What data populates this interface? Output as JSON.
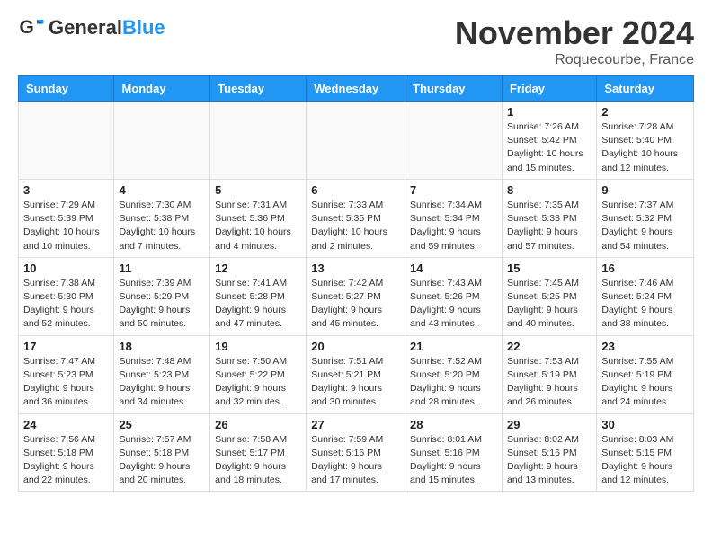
{
  "header": {
    "logo_line1": "General",
    "logo_line2": "Blue",
    "month": "November 2024",
    "location": "Roquecourbe, France"
  },
  "days_of_week": [
    "Sunday",
    "Monday",
    "Tuesday",
    "Wednesday",
    "Thursday",
    "Friday",
    "Saturday"
  ],
  "weeks": [
    [
      {
        "day": "",
        "info": ""
      },
      {
        "day": "",
        "info": ""
      },
      {
        "day": "",
        "info": ""
      },
      {
        "day": "",
        "info": ""
      },
      {
        "day": "",
        "info": ""
      },
      {
        "day": "1",
        "info": "Sunrise: 7:26 AM\nSunset: 5:42 PM\nDaylight: 10 hours and 15 minutes."
      },
      {
        "day": "2",
        "info": "Sunrise: 7:28 AM\nSunset: 5:40 PM\nDaylight: 10 hours and 12 minutes."
      }
    ],
    [
      {
        "day": "3",
        "info": "Sunrise: 7:29 AM\nSunset: 5:39 PM\nDaylight: 10 hours and 10 minutes."
      },
      {
        "day": "4",
        "info": "Sunrise: 7:30 AM\nSunset: 5:38 PM\nDaylight: 10 hours and 7 minutes."
      },
      {
        "day": "5",
        "info": "Sunrise: 7:31 AM\nSunset: 5:36 PM\nDaylight: 10 hours and 4 minutes."
      },
      {
        "day": "6",
        "info": "Sunrise: 7:33 AM\nSunset: 5:35 PM\nDaylight: 10 hours and 2 minutes."
      },
      {
        "day": "7",
        "info": "Sunrise: 7:34 AM\nSunset: 5:34 PM\nDaylight: 9 hours and 59 minutes."
      },
      {
        "day": "8",
        "info": "Sunrise: 7:35 AM\nSunset: 5:33 PM\nDaylight: 9 hours and 57 minutes."
      },
      {
        "day": "9",
        "info": "Sunrise: 7:37 AM\nSunset: 5:32 PM\nDaylight: 9 hours and 54 minutes."
      }
    ],
    [
      {
        "day": "10",
        "info": "Sunrise: 7:38 AM\nSunset: 5:30 PM\nDaylight: 9 hours and 52 minutes."
      },
      {
        "day": "11",
        "info": "Sunrise: 7:39 AM\nSunset: 5:29 PM\nDaylight: 9 hours and 50 minutes."
      },
      {
        "day": "12",
        "info": "Sunrise: 7:41 AM\nSunset: 5:28 PM\nDaylight: 9 hours and 47 minutes."
      },
      {
        "day": "13",
        "info": "Sunrise: 7:42 AM\nSunset: 5:27 PM\nDaylight: 9 hours and 45 minutes."
      },
      {
        "day": "14",
        "info": "Sunrise: 7:43 AM\nSunset: 5:26 PM\nDaylight: 9 hours and 43 minutes."
      },
      {
        "day": "15",
        "info": "Sunrise: 7:45 AM\nSunset: 5:25 PM\nDaylight: 9 hours and 40 minutes."
      },
      {
        "day": "16",
        "info": "Sunrise: 7:46 AM\nSunset: 5:24 PM\nDaylight: 9 hours and 38 minutes."
      }
    ],
    [
      {
        "day": "17",
        "info": "Sunrise: 7:47 AM\nSunset: 5:23 PM\nDaylight: 9 hours and 36 minutes."
      },
      {
        "day": "18",
        "info": "Sunrise: 7:48 AM\nSunset: 5:23 PM\nDaylight: 9 hours and 34 minutes."
      },
      {
        "day": "19",
        "info": "Sunrise: 7:50 AM\nSunset: 5:22 PM\nDaylight: 9 hours and 32 minutes."
      },
      {
        "day": "20",
        "info": "Sunrise: 7:51 AM\nSunset: 5:21 PM\nDaylight: 9 hours and 30 minutes."
      },
      {
        "day": "21",
        "info": "Sunrise: 7:52 AM\nSunset: 5:20 PM\nDaylight: 9 hours and 28 minutes."
      },
      {
        "day": "22",
        "info": "Sunrise: 7:53 AM\nSunset: 5:19 PM\nDaylight: 9 hours and 26 minutes."
      },
      {
        "day": "23",
        "info": "Sunrise: 7:55 AM\nSunset: 5:19 PM\nDaylight: 9 hours and 24 minutes."
      }
    ],
    [
      {
        "day": "24",
        "info": "Sunrise: 7:56 AM\nSunset: 5:18 PM\nDaylight: 9 hours and 22 minutes."
      },
      {
        "day": "25",
        "info": "Sunrise: 7:57 AM\nSunset: 5:18 PM\nDaylight: 9 hours and 20 minutes."
      },
      {
        "day": "26",
        "info": "Sunrise: 7:58 AM\nSunset: 5:17 PM\nDaylight: 9 hours and 18 minutes."
      },
      {
        "day": "27",
        "info": "Sunrise: 7:59 AM\nSunset: 5:16 PM\nDaylight: 9 hours and 17 minutes."
      },
      {
        "day": "28",
        "info": "Sunrise: 8:01 AM\nSunset: 5:16 PM\nDaylight: 9 hours and 15 minutes."
      },
      {
        "day": "29",
        "info": "Sunrise: 8:02 AM\nSunset: 5:16 PM\nDaylight: 9 hours and 13 minutes."
      },
      {
        "day": "30",
        "info": "Sunrise: 8:03 AM\nSunset: 5:15 PM\nDaylight: 9 hours and 12 minutes."
      }
    ]
  ]
}
